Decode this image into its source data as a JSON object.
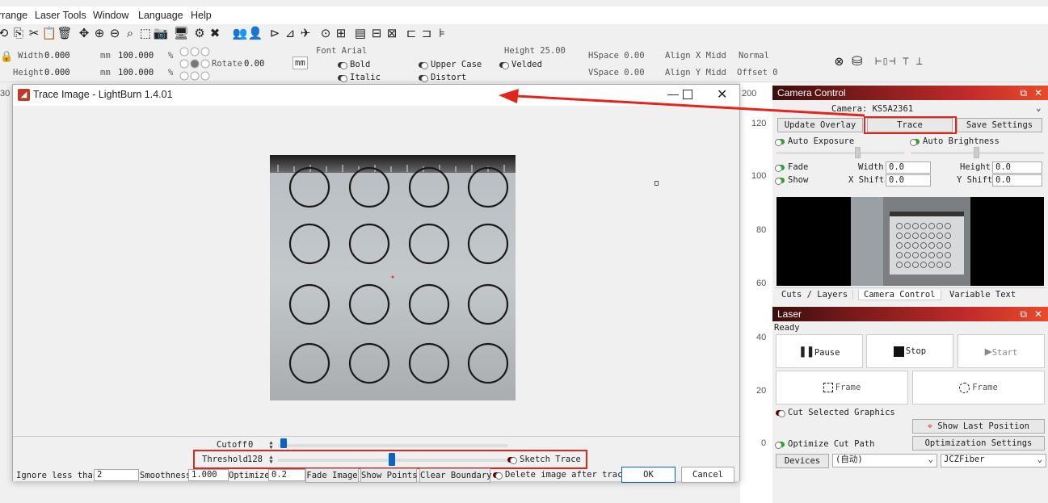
{
  "menu": [
    "rrange",
    "Laser Tools",
    "Window",
    "Language",
    "Help"
  ],
  "props": {
    "width_label": "Width",
    "width_val": "0.000",
    "height_label": "Height",
    "height_val": "0.000",
    "unit": "mm",
    "pct_w": "100.000",
    "pct_h": "100.000",
    "pct": "%",
    "rotate_label": "Rotate",
    "rotate_val": "0.00",
    "mm_btn": "mm",
    "font": "Font Arial",
    "fheight": "Height 25.00",
    "hspace": "HSpace 0.00",
    "vspace": "VSpace 0.00",
    "align_x": "Align X Midd",
    "align_y": "Align Y Midd",
    "normal": "Normal",
    "offset": "Offset 0",
    "bold": "Bold",
    "italic": "Italic",
    "upper": "Upper Case",
    "distort": "Distort",
    "welded": "Velded"
  },
  "ruler": [
    "120",
    "100",
    "80",
    "60",
    "40",
    "20",
    "0"
  ],
  "ruler_top": [
    "30",
    "200"
  ],
  "dialog": {
    "title": "Trace Image - LightBurn 1.4.01",
    "cutoff_label": "Cutoff",
    "cutoff_val": "0",
    "threshold_label": "Threshold",
    "threshold_val": "128",
    "sketch_label": "Sketch Trace",
    "ignore_label": "Ignore less than",
    "ignore_val": "2",
    "smooth_label": "Smoothness",
    "smooth_val": "1.000",
    "optimize_label": "Optimize",
    "optimize_val": "0.2",
    "fade_btn": "Fade Image",
    "points_btn": "Show Points",
    "clear_btn": "Clear Boundary",
    "delete_label": "Delete image after trace",
    "ok_btn": "OK",
    "cancel_btn": "Cancel"
  },
  "camera": {
    "title": "Camera Control",
    "camera_label": "Camera: KS5A2361",
    "update_btn": "Update Overlay",
    "trace_btn": "Trace",
    "save_btn": "Save Settings",
    "auto_exposure": "Auto Exposure",
    "auto_brightness": "Auto Brightness",
    "fade": "Fade",
    "show": "Show",
    "width_label": "Width",
    "width_val": "0.0",
    "height_label": "Height",
    "height_val": "0.0",
    "xshift_label": "X Shift",
    "xshift_val": "0.0",
    "yshift_label": "Y Shift",
    "yshift_val": "0.0",
    "tabs": [
      "Cuts / Layers",
      "Camera Control",
      "Variable Text"
    ]
  },
  "laser": {
    "title": "Laser",
    "status": "Ready",
    "pause": "Pause",
    "stop": "Stop",
    "start": "Start",
    "frame1": "Frame",
    "frame2": "Frame",
    "cut_selected": "Cut Selected Graphics",
    "show_last": "Show Last Position",
    "optimize_cut": "Optimize Cut Path",
    "opt_settings": "Optimization Settings",
    "devices": "Devices",
    "auto": "(自动)",
    "device": "JCZFiber"
  },
  "colors": {
    "accent": "#0a64c8",
    "annotation": "#e3261b"
  }
}
